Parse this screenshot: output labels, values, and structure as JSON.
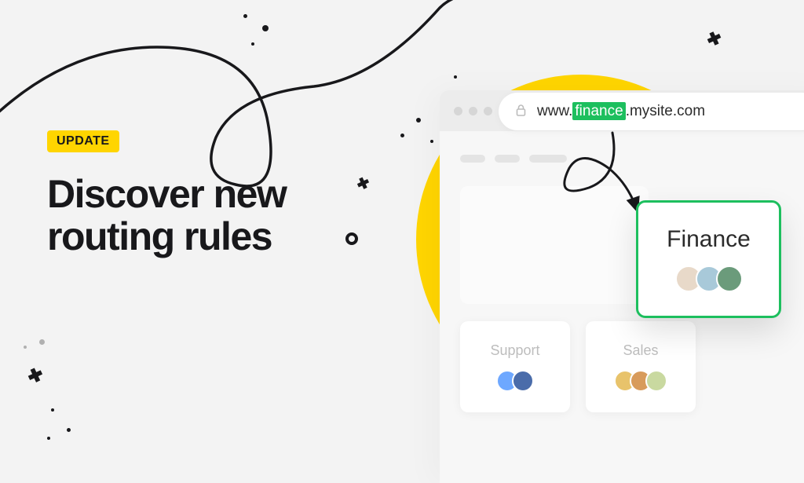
{
  "badge": "UPDATE",
  "headline_line1": "Discover new",
  "headline_line2": "routing rules",
  "url": {
    "prefix": "www.",
    "highlight": "finance",
    "suffix": ".mysite.com"
  },
  "teams": {
    "support": {
      "label": "Support"
    },
    "sales": {
      "label": "Sales"
    },
    "finance": {
      "label": "Finance"
    }
  },
  "avatar_colors": {
    "support": [
      "#6ea8ff",
      "#4a6caa"
    ],
    "sales": [
      "#e8c36b",
      "#d89b5b",
      "#c9d9a0"
    ],
    "finance": [
      "#e8d9c9",
      "#a8c9d9",
      "#6b9b7b"
    ]
  }
}
